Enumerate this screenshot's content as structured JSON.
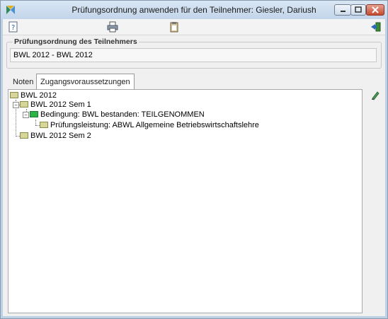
{
  "window": {
    "title": "Prüfungsordnung anwenden für den Teilnehmer: Giesler, Dariush",
    "controls": [
      "minimize-icon",
      "maximize-icon",
      "close-icon"
    ]
  },
  "toolbar": {
    "icons": [
      "help-icon",
      "print-icon",
      "clipboard-icon",
      "exit-icon"
    ]
  },
  "group": {
    "label": "Prüfungsordnung des Teilnehmers",
    "value": "BWL 2012 - BWL 2012"
  },
  "tabs": [
    {
      "label": "Noten",
      "active": false
    },
    {
      "label": "Zugangsvoraussetzungen",
      "active": true
    }
  ],
  "tree": [
    {
      "label": "BWL 2012",
      "level": 0,
      "icon": "folder-icon"
    },
    {
      "label": "BWL 2012 Sem 1",
      "level": 1,
      "icon": "folder-icon",
      "expanded": true
    },
    {
      "label": "Bedingung: BWL bestanden: TEILGENOMMEN",
      "level": 2,
      "icon": "folder-green-icon",
      "expanded": true
    },
    {
      "label": "Prüfungsleistung: ABWL Allgemeine Betriebswirtschaftslehre",
      "level": 3,
      "icon": "folder-icon"
    },
    {
      "label": "BWL 2012 Sem 2",
      "level": 1,
      "icon": "folder-icon"
    }
  ],
  "side": {
    "icon": "pencil-icon"
  }
}
